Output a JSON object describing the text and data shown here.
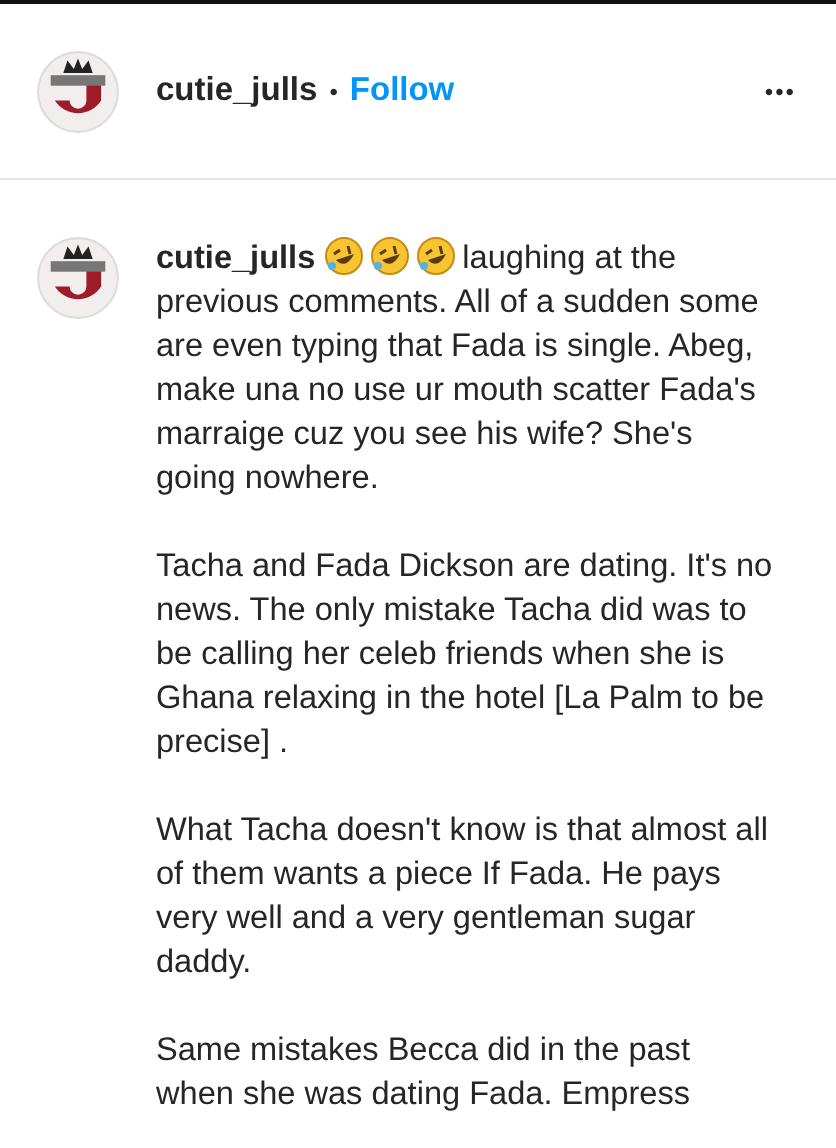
{
  "header": {
    "username": "cutie_julls",
    "separator": "•",
    "follow": "Follow",
    "more": "•••"
  },
  "comment": {
    "username": "cutie_julls",
    "emojis": [
      {
        "kind": "rofl"
      },
      {
        "kind": "rofl"
      },
      {
        "kind": "rofl"
      }
    ],
    "paragraphs": [
      "laughing at the previous comments. All of a sudden some are even typing that Fada is single. Abeg, make una no use ur mouth scatter Fada's marraige cuz you see his wife? She's going nowhere.",
      "Tacha and Fada Dickson are dating. It's no news. The only mistake Tacha did was to be calling her celeb friends when she is Ghana relaxing in the hotel [La Palm to be precise] .",
      "What Tacha doesn't know is that almost all of them wants a piece If Fada. He pays very well and a very gentleman sugar daddy.",
      "Same mistakes Becca did in the past when she was dating Fada. Empress"
    ]
  }
}
